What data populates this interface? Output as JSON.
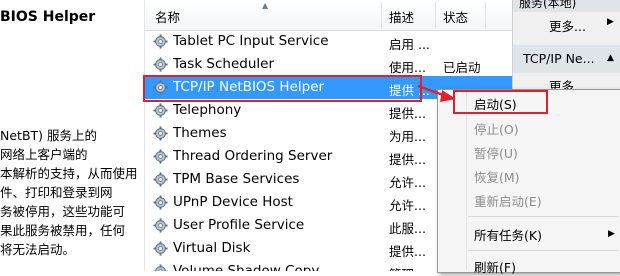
{
  "left": {
    "title": "BIOS Helper",
    "description_lines": [
      "NetBT) 服务上的",
      "网络上客户端的",
      "本解析的支持，从而使用",
      "件、打印和登录到网",
      "务被停用，这些功能可",
      "果此服务被禁用，任何",
      "将无法启动。"
    ]
  },
  "table": {
    "columns": {
      "name": "名称",
      "desc": "描述",
      "status": "状态"
    },
    "rows": [
      {
        "name": "Tablet PC Input Service",
        "desc": "启用 ...",
        "status": ""
      },
      {
        "name": "Task Scheduler",
        "desc": "使用...",
        "status": "已启动"
      },
      {
        "name": "TCP/IP NetBIOS Helper",
        "desc": "提供 ...",
        "status": ""
      },
      {
        "name": "Telephony",
        "desc": "提供...",
        "status": ""
      },
      {
        "name": "Themes",
        "desc": "为用...",
        "status": ""
      },
      {
        "name": "Thread Ordering Server",
        "desc": "提供...",
        "status": ""
      },
      {
        "name": "TPM Base Services",
        "desc": "允许...",
        "status": ""
      },
      {
        "name": "UPnP Device Host",
        "desc": "允许...",
        "status": ""
      },
      {
        "name": "User Profile Service",
        "desc": "此服...",
        "status": ""
      },
      {
        "name": "Virtual Disk",
        "desc": "提供...",
        "status": ""
      },
      {
        "name": "Volume Shadow Copy",
        "desc": "管理...",
        "status": ""
      }
    ]
  },
  "actions": {
    "top_label": "服务(本地)",
    "more1": "更多...",
    "section": "TCP/IP Ne...",
    "more2": "更多..."
  },
  "context_menu": {
    "start": "启动(S)",
    "stop": "停止(O)",
    "pause": "暂停(U)",
    "resume": "恢复(M)",
    "restart": "重新启动(E)",
    "all_tasks": "所有任务(K)",
    "refresh": "刷新(F)"
  },
  "colors": {
    "selection": "#3399ff",
    "highlight": "#e0202a"
  }
}
